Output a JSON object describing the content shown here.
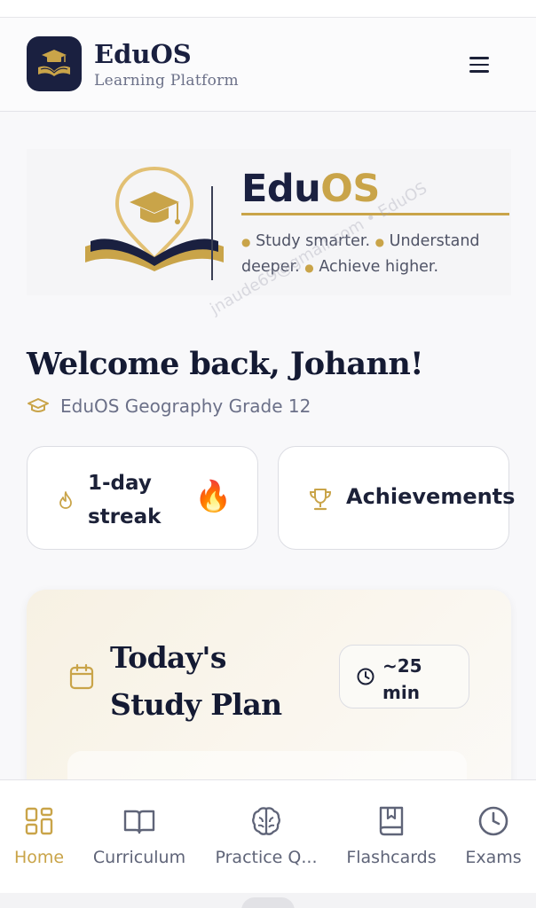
{
  "header": {
    "brand_name": "EduOS",
    "brand_subtitle": "Learning Platform"
  },
  "banner": {
    "title_part1": "Edu",
    "title_part2": "OS",
    "tagline_1": "Study smarter.",
    "tagline_2": "Understand deeper.",
    "tagline_3": "Achieve higher.",
    "watermark": "jnaude69@gmail.com • EduOS"
  },
  "welcome": {
    "greeting": "Welcome back, Johann!",
    "course": "EduOS Geography Grade 12"
  },
  "cards": {
    "streak_label": "1-day streak",
    "streak_emoji": "🔥",
    "achievements_label": "Achievements"
  },
  "study_plan": {
    "title": "Today's Study Plan",
    "duration": "~25 min"
  },
  "bottom_nav": {
    "items": [
      {
        "label": "Home",
        "icon": "home-grid-icon",
        "active": true
      },
      {
        "label": "Curriculum",
        "icon": "book-open-icon",
        "active": false
      },
      {
        "label": "Practice Q...",
        "icon": "brain-icon",
        "active": false
      },
      {
        "label": "Flashcards",
        "icon": "flashcard-book-icon",
        "active": false
      },
      {
        "label": "Exams",
        "icon": "clock-icon",
        "active": false
      }
    ]
  },
  "colors": {
    "navy": "#1a2040",
    "gold": "#c9a449",
    "muted": "#6b7088"
  }
}
